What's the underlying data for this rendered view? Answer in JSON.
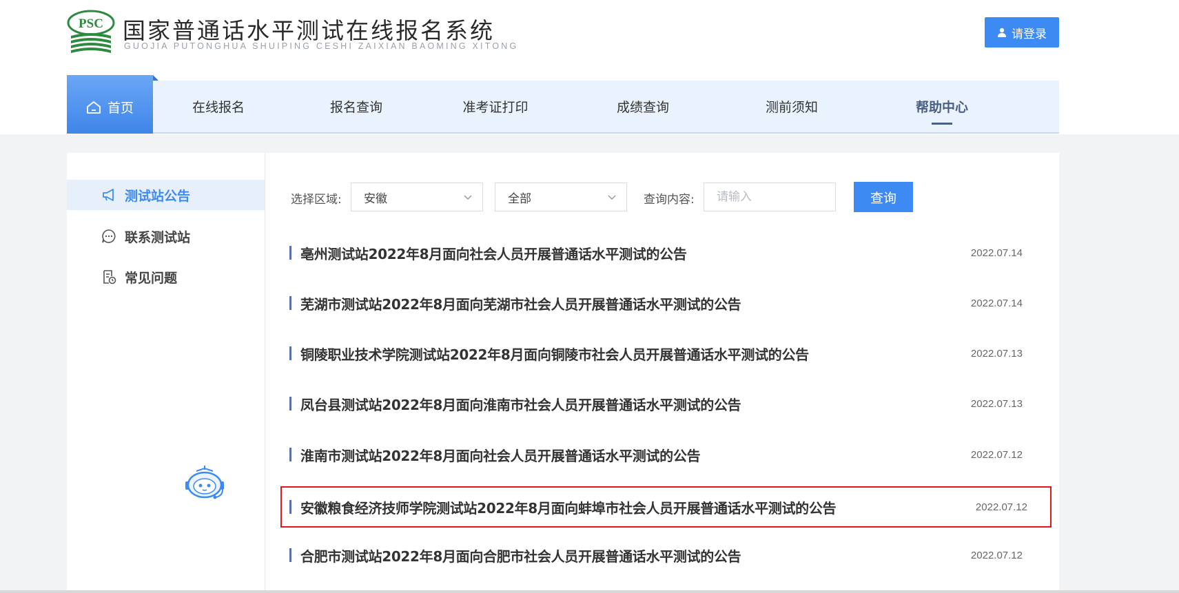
{
  "header": {
    "logo_text": "PSC",
    "title": "国家普通话水平测试在线报名系统",
    "subtitle": "GUOJIA PUTONGHUA SHUIPING CESHI ZAIXIAN BAOMING XITONG",
    "login_label": "请登录"
  },
  "nav": {
    "home_label": "首页",
    "items": [
      {
        "label": "在线报名"
      },
      {
        "label": "报名查询"
      },
      {
        "label": "准考证打印"
      },
      {
        "label": "成绩查询"
      },
      {
        "label": "测前须知"
      },
      {
        "label": "帮助中心",
        "active": true
      }
    ]
  },
  "sidebar": {
    "items": [
      {
        "label": "测试站公告",
        "icon": "megaphone-icon",
        "active": true
      },
      {
        "label": "联系测试站",
        "icon": "chat-icon"
      },
      {
        "label": "常见问题",
        "icon": "document-clock-icon"
      }
    ]
  },
  "filters": {
    "region_label": "选择区域:",
    "province_value": "安徽",
    "station_value": "全部",
    "query_label": "查询内容:",
    "query_placeholder": "请输入",
    "query_button": "查询"
  },
  "notices": [
    {
      "title": "亳州测试站2022年8月面向社会人员开展普通话水平测试的公告",
      "date": "2022.07.14"
    },
    {
      "title": "芜湖市测试站2022年8月面向芜湖市社会人员开展普通话水平测试的公告",
      "date": "2022.07.14"
    },
    {
      "title": "铜陵职业技术学院测试站2022年8月面向铜陵市社会人员开展普通话水平测试的公告",
      "date": "2022.07.13"
    },
    {
      "title": "凤台县测试站2022年8月面向淮南市社会人员开展普通话水平测试的公告",
      "date": "2022.07.13"
    },
    {
      "title": "淮南市测试站2022年8月面向社会人员开展普通话水平测试的公告",
      "date": "2022.07.12"
    },
    {
      "title": "安徽粮食经济技师学院测试站2022年8月面向蚌埠市社会人员开展普通话水平测试的公告",
      "date": "2022.07.12",
      "highlighted": true
    },
    {
      "title": "合肥市测试站2022年8月面向合肥市社会人员开展普通话水平测试的公告",
      "date": "2022.07.12"
    }
  ],
  "colors": {
    "accent": "#3d8bf2",
    "nav_bg": "#eaf2fd",
    "highlight_border": "#e01818"
  }
}
